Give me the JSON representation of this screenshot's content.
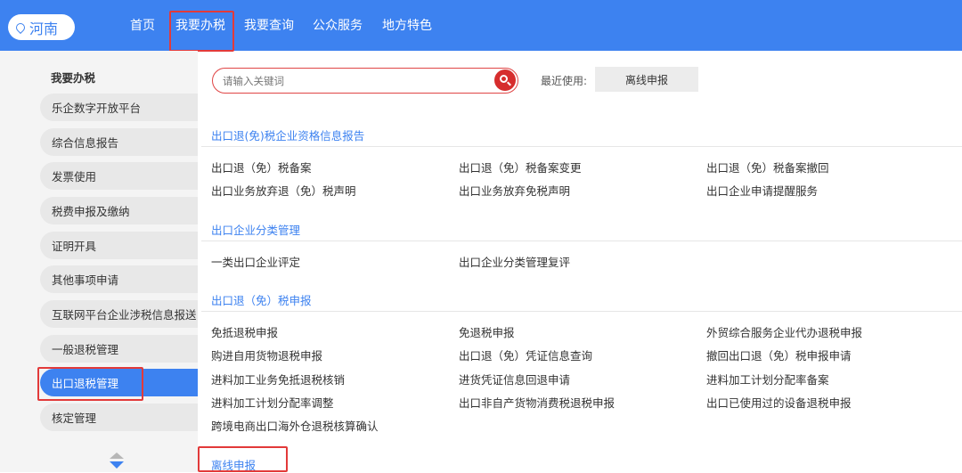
{
  "header": {
    "region": "河南",
    "nav": [
      "首页",
      "我要办税",
      "我要查询",
      "公众服务",
      "地方特色"
    ]
  },
  "sidebar": {
    "title": "我要办税",
    "items": [
      "乐企数字开放平台",
      "综合信息报告",
      "发票使用",
      "税费申报及缴纳",
      "证明开具",
      "其他事项申请",
      "互联网平台企业涉税信息报送",
      "一般退税管理",
      "出口退税管理",
      "核定管理"
    ],
    "active_index": 8
  },
  "search": {
    "placeholder": "请输入关键词",
    "recent_label": "最近使用:",
    "recent_item": "离线申报"
  },
  "sections": [
    {
      "title": "出口退(免)税企业资格信息报告",
      "rows": [
        [
          "出口退（免）税备案",
          "出口退（免）税备案变更",
          "出口退（免）税备案撤回"
        ],
        [
          "出口业务放弃退（免）税声明",
          "出口业务放弃免税声明",
          "出口企业申请提醒服务"
        ]
      ]
    },
    {
      "title": "出口企业分类管理",
      "rows": [
        [
          "一类出口企业评定",
          "出口企业分类管理复评"
        ]
      ]
    },
    {
      "title": "出口退（免）税申报",
      "rows": [
        [
          "免抵退税申报",
          "免退税申报",
          "外贸综合服务企业代办退税申报"
        ],
        [
          "购进自用货物退税申报",
          "出口退（免）凭证信息查询",
          "撤回出口退（免）税申报申请"
        ],
        [
          "进料加工业务免抵退税核销",
          "进货凭证信息回退申请",
          "进料加工计划分配率备案"
        ],
        [
          "进料加工计划分配率调整",
          "出口非自产货物消费税退税申报",
          "出口已使用过的设备退税申报"
        ],
        [
          "跨境电商出口海外仓退税核算确认"
        ]
      ]
    },
    {
      "title": "离线申报",
      "rows": []
    }
  ],
  "colors": {
    "brand_blue": "#3d82f0",
    "highlight_red": "#e23a3a"
  }
}
